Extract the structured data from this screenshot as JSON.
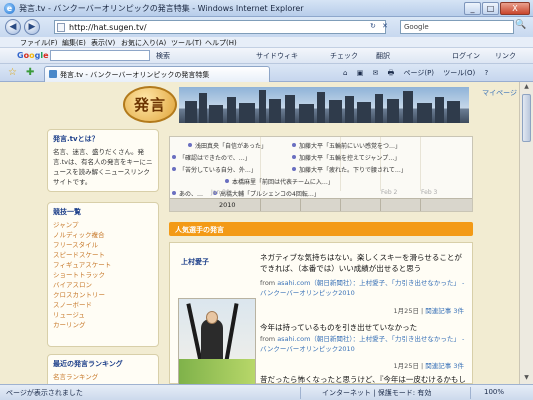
{
  "window": {
    "title": "発言.tv - バンクーバーオリンピックの発言特集 - Windows Internet Explorer",
    "buttons": [
      "_",
      "□",
      "X"
    ]
  },
  "nav": {
    "back": "◀",
    "forward": "▶",
    "url": "http://hat.sugen.tv/",
    "refresh_stop": "↻ ✕",
    "search_placeholder": "Google",
    "search_go": "🔍"
  },
  "menu": [
    "ファイル(F)",
    "編集(E)",
    "表示(V)",
    "お気に入り(A)",
    "ツール(T)",
    "ヘルプ(H)"
  ],
  "google_toolbar": {
    "logo": [
      "G",
      "o",
      "o",
      "g",
      "l",
      "e"
    ],
    "search_go": "検索",
    "items": [
      "サイドウィキ",
      "チェック",
      "翻訳",
      "ログイン",
      "リンク"
    ]
  },
  "tab": {
    "label": "発言.tv - バンクーバーオリンピックの発言特集",
    "favorites_star": "☆",
    "add_favorite": "✚"
  },
  "commands": [
    "⌂",
    "▣",
    "✉",
    "🖶",
    "ページ(P)",
    "ツール(O)",
    "?"
  ],
  "page": {
    "mypage": "マイページ",
    "logo_text": "発言",
    "about": {
      "title": "発言.tvとは？",
      "body": "名言、迷言、盛りだくさん。発言.tvは、有名人の発言をキーにニュースを読み解くニュースリンクサイトです。"
    },
    "sports": {
      "title": "競技一覧",
      "items": [
        "ジャンプ",
        "ノルディック複合",
        "フリースタイル",
        "スピードスケート",
        "フィギュアスケート",
        "ショートトラック",
        "バイアスロン",
        "クロスカントリー",
        "スノーボード",
        "リュージュ",
        "カーリング"
      ]
    },
    "ranking": {
      "title": "最近の発言ランキング",
      "subtitle": "名言ランキング"
    },
    "timeline": {
      "events": [
        "浅田真央「自信があった」",
        "加藤大平「五輪前にいい感覚をつ…」",
        "「確認はできたので、…」",
        "加藤大平「五輪を控えてジャンプ…」",
        "「苦労している自分、外…」",
        "加藤大平「疲れた。下りで腰されて…」",
        "本橋麻里「前回は代表チームに入…」",
        "高橋大輔「プルシェンコの4回転…」",
        "あの、…"
      ],
      "days": [
        "Jan 30",
        "Feb 2",
        "Feb 3"
      ],
      "year": "2010"
    },
    "section_title": "人気選手の発言",
    "article": {
      "athlete": "上村愛子",
      "quote1": "ネガティブな気持ちはない。楽しくスキーを滑らせることができれば、（本番では）いい成績が出せると思う",
      "source1_prefix": "from ",
      "source1_link": "asahi.com（朝日新聞社）：上村愛子、「力引き出せなかった」 - バンクーバーオリンピック2010",
      "date1": "1月25日",
      "related1": "関連記事 3件",
      "quote2": "今年は持っているものを引き出せていなかった",
      "source2_prefix": "from ",
      "source2_link": "asahi.com（朝日新聞社）：上村愛子、「力引き出せなかった」 - バンクーバーオリンピック2010",
      "date2": "1月25日",
      "related2": "関連記事 3件",
      "quote3": "昔だったら怖くなったと思うけど、『今年は一皮むけるかもしれん』というネガティブさはがな。そのぶり、自分でも驚く"
    }
  },
  "status": {
    "text": "ページが表示されました",
    "zone": "インターネット | 保護モード: 有効",
    "zoom": "100%"
  },
  "colors": {
    "section_orange": "#f39a16",
    "link_blue": "#3b73b8",
    "page_bg": "#f2ecd2"
  }
}
